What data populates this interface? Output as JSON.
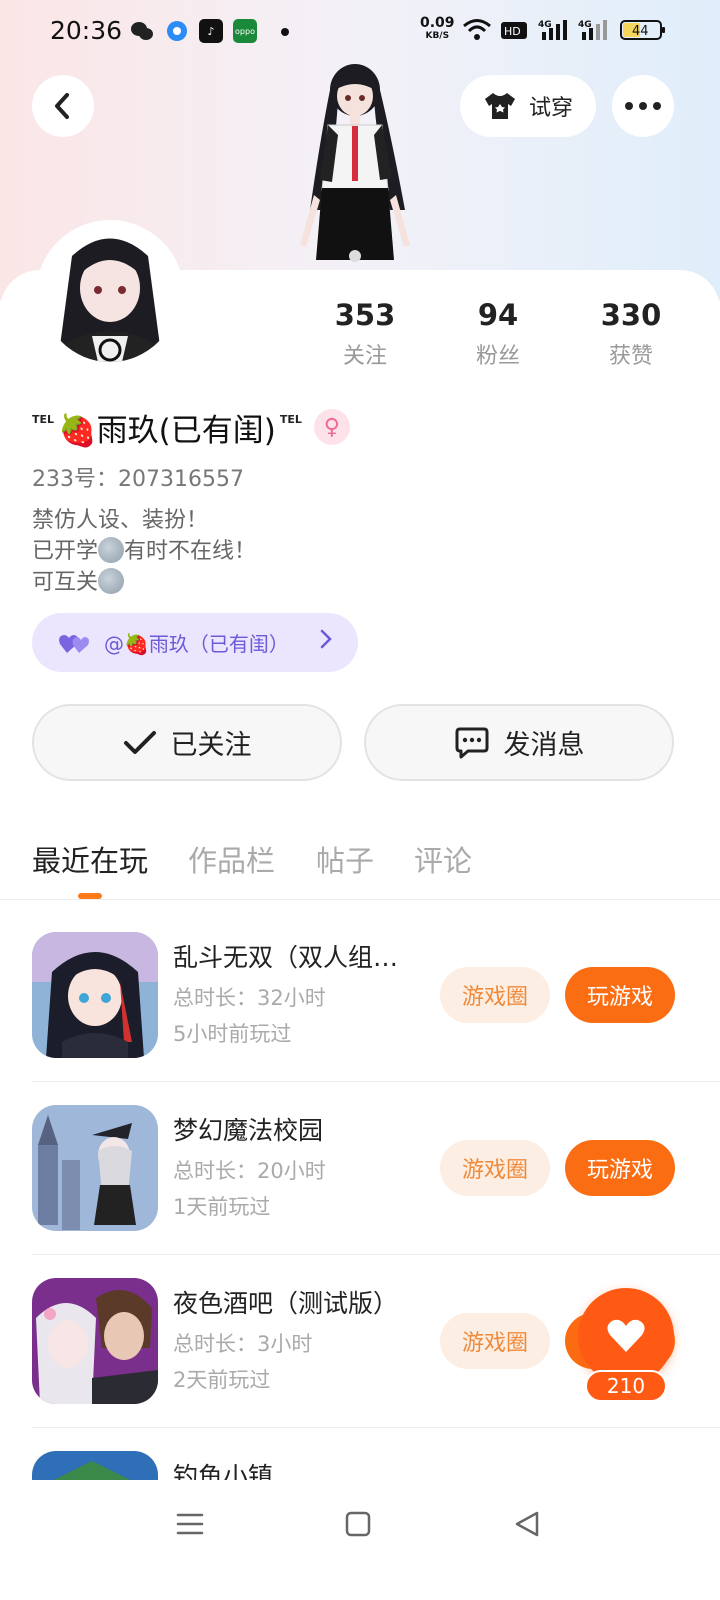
{
  "status_bar": {
    "time": "20:36",
    "net_speed": "0.09",
    "net_unit": "KB/S",
    "hd": "HD2",
    "sig1": "4G",
    "sig2": "4G",
    "battery": "44",
    "apps": [
      "wechat-icon",
      "browser-icon",
      "tiktok-icon",
      "oppo-icon"
    ]
  },
  "header": {
    "tryon_label": "试穿"
  },
  "stats": [
    {
      "value": "353",
      "label": "关注"
    },
    {
      "value": "94",
      "label": "粉丝"
    },
    {
      "value": "330",
      "label": "获赞"
    }
  ],
  "profile": {
    "tel_left": "TEL",
    "name": "🍓雨玖(已有闺)",
    "tel_right": "TEL",
    "gender_symbol": "♀",
    "uid": "233号：207316557",
    "bio_1": "禁仿人设、装扮！",
    "bio_2a": "已开学",
    "bio_2b": "有时不在线！",
    "bio_3": "可互关",
    "cp_tag": "@🍓雨玖（已有闺）"
  },
  "actions": {
    "follow": "已关注",
    "message": "发消息"
  },
  "tabs": [
    "最近在玩",
    "作品栏",
    "帖子",
    "评论"
  ],
  "games": [
    {
      "title": "乱斗无双（双人组…",
      "duration": "总时长：32小时",
      "ago": "5小时前玩过",
      "circle": "游戏圈",
      "play": "玩游戏"
    },
    {
      "title": "梦幻魔法校园",
      "duration": "总时长：20小时",
      "ago": "1天前玩过",
      "circle": "游戏圈",
      "play": "玩游戏"
    },
    {
      "title": "夜色酒吧（测试版）",
      "duration": "总时长：3小时",
      "ago": "2天前玩过",
      "circle": "游戏圈",
      "play": "玩游戏"
    },
    {
      "title": "钓鱼小镇"
    }
  ],
  "like_count": "210",
  "colors": {
    "accent": "#fb6d12",
    "cp_chip": "#ebe6fd",
    "gender_bg": "#fde2ea"
  }
}
